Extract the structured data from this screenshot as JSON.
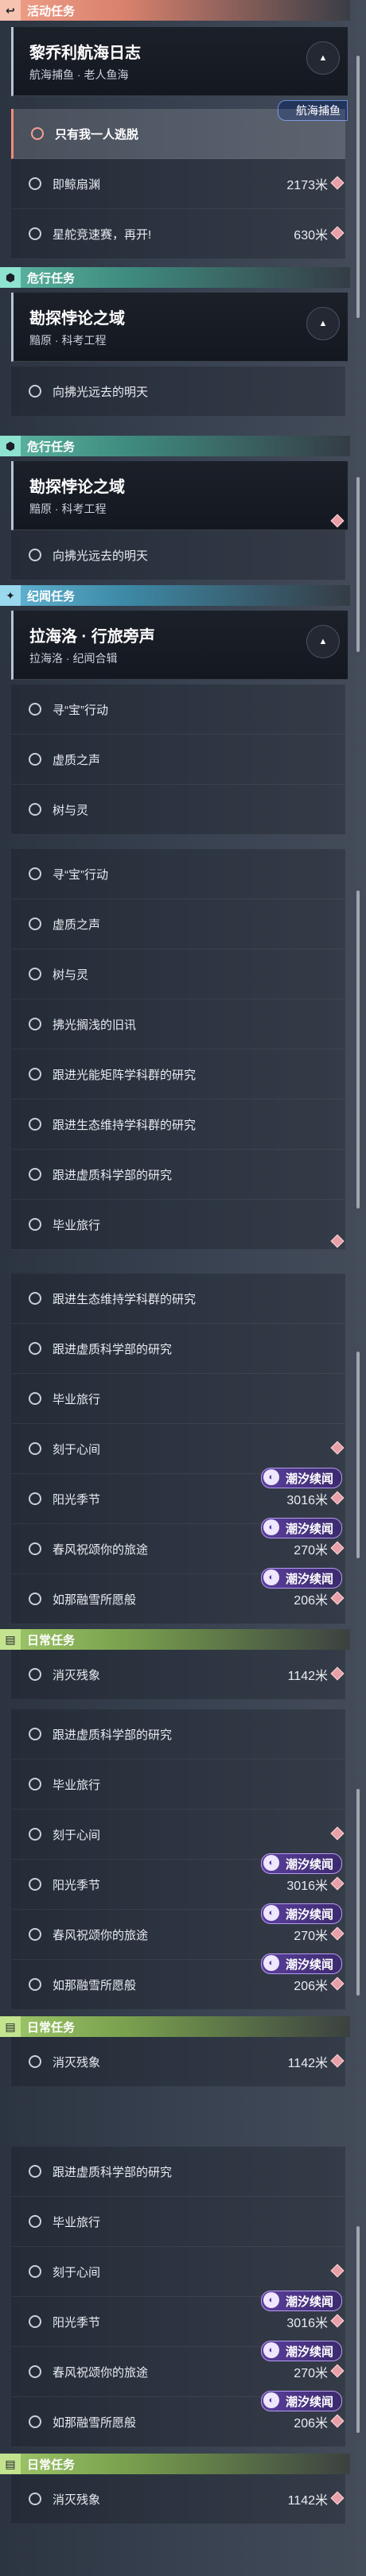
{
  "categories": {
    "activity": "活动任务",
    "danger": "危行任务",
    "record": "纪闻任务",
    "daily": "日常任务"
  },
  "icons": {
    "activity": "return-arrow-icon",
    "danger": "hexagon-leaf-icon",
    "record": "sparkle-star-icon",
    "daily": "open-book-icon",
    "chip": "tide-swirl-icon",
    "collapse": "chevron-up-icon"
  },
  "tasks": {
    "fishing_log": {
      "title": "黎乔利航海日志",
      "subtitle": "航海捕鱼 · 老人鱼海",
      "tag": "航海捕鱼"
    },
    "explore": {
      "title": "勘探悖论之域",
      "subtitle": "黯原 · 科考工程"
    },
    "trip": {
      "title": "拉海洛 · 行旅旁声",
      "subtitle": "拉海洛 · 纪闻合辑"
    }
  },
  "items": {
    "alone": "只有我一人逃脱",
    "hunt": "即鲸扇渊",
    "hunt_dist": "2173米",
    "starship": "星舵竞速赛，再开!",
    "starship_dist": "630米",
    "toward_light": "向拂光远去的明天",
    "treasure": "寻“宝”行动",
    "void_voice": "虚质之声",
    "tree_spirit": "树与灵",
    "memory": "拂光搁浅的旧讯",
    "light_energy": "跟进光能矩阵学科群的研究",
    "eco": "跟进生态维持学科群的研究",
    "void_science": "跟进虚质科学部的研究",
    "grad_trip": "毕业旅行",
    "heart": "刻于心间",
    "sun_season": "阳光季节",
    "sun_dist": "3016米",
    "spring_wish": "春风祝颂你的旅途",
    "spring_dist": "270米",
    "snow_wish": "如那融雪所愿般",
    "snow_dist": "206米",
    "wipe_echo": "消灭残象",
    "wipe_dist": "1142米",
    "tide_chip": "潮汐续闻"
  }
}
